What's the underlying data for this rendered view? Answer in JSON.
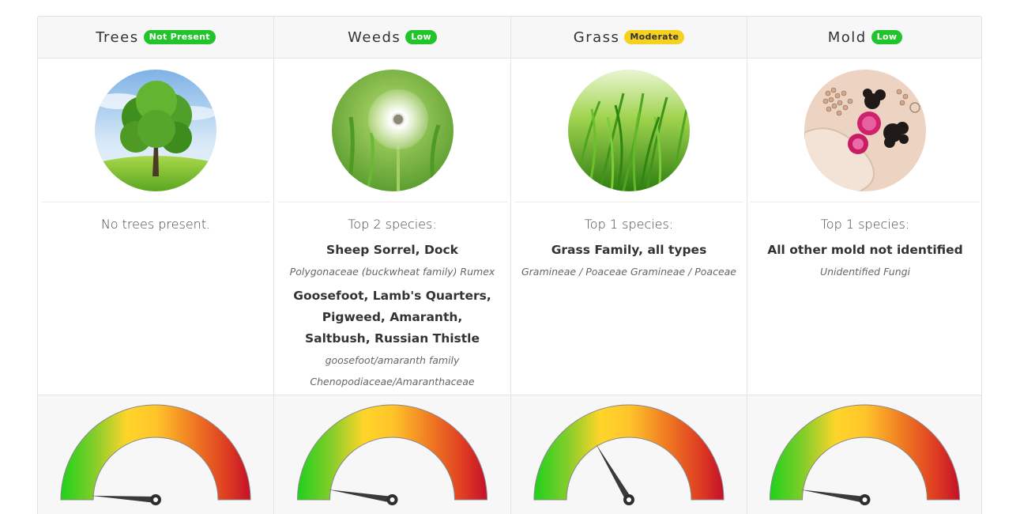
{
  "columns": [
    {
      "name": "Trees",
      "badge": "Not Present",
      "badge_color": "#21c42a",
      "photo": "tree-photo",
      "intro": "No trees present.",
      "species": [],
      "gauge_level": 0.02
    },
    {
      "name": "Weeds",
      "badge": "Low",
      "badge_color": "#21c42a",
      "photo": "dandelion-photo",
      "intro": "Top 2 species:",
      "species": [
        {
          "name": "Sheep Sorrel, Dock",
          "scientific": [
            "Polygonaceae (buckwheat family) Rumex"
          ]
        },
        {
          "name": "Goosefoot, Lamb's Quarters, Pigweed, Amaranth, Saltbush, Russian Thistle",
          "scientific": [
            "goosefoot/amaranth family",
            "Chenopodiaceae/Amaranthaceae"
          ]
        }
      ],
      "gauge_level": 0.05
    },
    {
      "name": "Grass",
      "badge": "Moderate",
      "badge_color": "#f6d21f",
      "photo": "grass-photo",
      "intro": "Top 1 species:",
      "species": [
        {
          "name": "Grass Family, all types",
          "scientific": [
            "Gramineae / Poaceae Gramineae / Poaceae"
          ]
        }
      ],
      "gauge_level": 0.33
    },
    {
      "name": "Mold",
      "badge": "Low",
      "badge_color": "#21c42a",
      "photo": "mold-spores-photo",
      "intro": "Top 1 species:",
      "species": [
        {
          "name": "All other mold not identified",
          "scientific": [
            "Unidentified Fungi"
          ]
        }
      ],
      "gauge_level": 0.05
    }
  ]
}
